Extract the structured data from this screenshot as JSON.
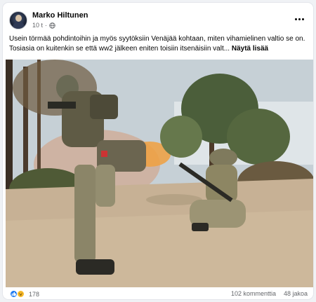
{
  "post": {
    "author": "Marko Hiltunen",
    "time": "10 t",
    "separator": "·",
    "text_line1": "Usein törmää pohdintoihin ja myös syytöksiin Venäjää kohtaan, miten vihamielinen valtio se on.",
    "text_line2": "Tosiasia on kuitenkin se että ww2 jälkeen eniten toisiin itsenäisiin valt...",
    "see_more": "Näytä lisää",
    "more_icon": "three-dots-icon",
    "privacy_icon": "globe-icon"
  },
  "stats": {
    "reaction_count": "178",
    "reaction_icons": [
      "like-icon",
      "haha-icon"
    ],
    "comments": "102 kommenttia",
    "shares": "48 jakoa"
  },
  "colors": {
    "accent": "#1877f2",
    "secondary_text": "#65676b",
    "background": "#f0f2f5"
  }
}
